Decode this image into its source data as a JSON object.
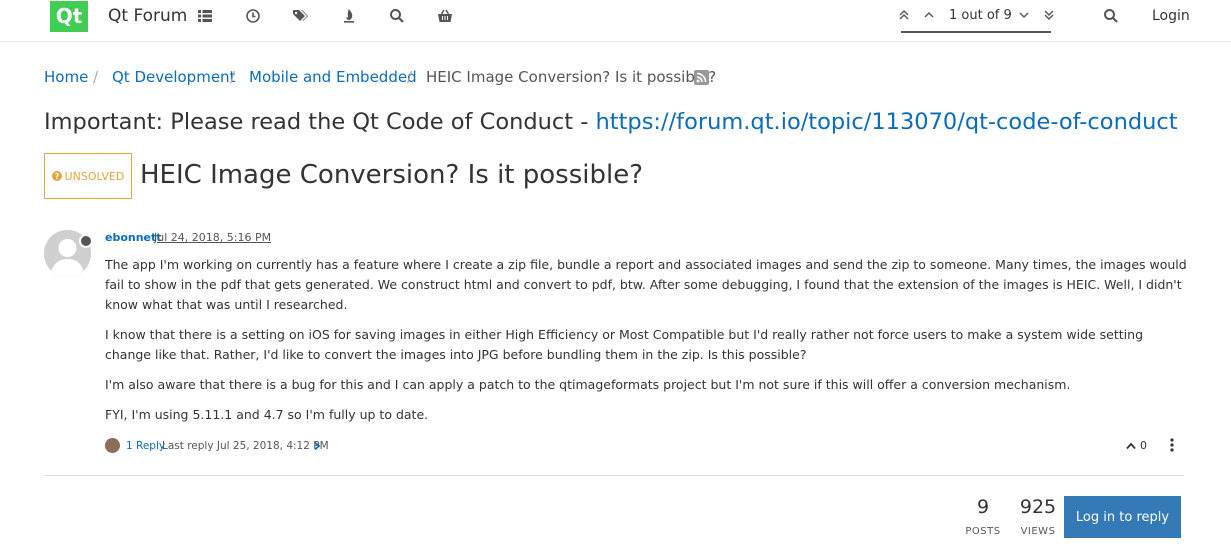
{
  "header": {
    "logo_text": "Qt",
    "brand": "Qt Forum",
    "nav_icons": [
      "categories-icon",
      "recent-icon",
      "tags-icon",
      "popular-icon",
      "search-icon",
      "shop-icon"
    ],
    "pager": {
      "text": "1 out of 9"
    },
    "search_icon": "search-icon",
    "login_label": "Login"
  },
  "breadcrumb": {
    "items": [
      "Home",
      "Qt Development",
      "Mobile and Embedded"
    ],
    "current": "HEIC Image Conversion? Is it possible?",
    "separator": "/"
  },
  "notice": {
    "text": "Important: Please read the Qt Code of Conduct - ",
    "link": "https://forum.qt.io/topic/113070/qt-code-of-conduct"
  },
  "topic": {
    "status": "UNSOLVED",
    "title": "HEIC Image Conversion? Is it possible?"
  },
  "post": {
    "author": "ebonnett",
    "timestamp": "Jul 24, 2018, 5:16 PM",
    "paragraphs": [
      "The app I'm working on currently has a feature where I create a zip file, bundle a report and associated images and send the zip to someone. Many times, the images would fail to show in the pdf that gets generated. We construct html and convert to pdf, btw. After some debugging, I found that the extension of the images is HEIC. Well, I didn't know what that was until I researched.",
      "I know that there is a setting on iOS for saving images in either High Efficiency or Most Compatible but I'd really rather not force users to make a system wide setting change like that. Rather, I'd like to convert the images into JPG before bundling them in the zip. Is this possible?",
      "I'm also aware that there is a bug for this and I can apply a patch to the qtimageformats project but I'm not sure if this will offer a conversion mechanism.",
      "FYI, I'm using 5.11.1 and 4.7 so I'm fully up to date."
    ],
    "replies_label": "1 Reply",
    "last_reply": "Last reply Jul 25, 2018, 4:12 PM",
    "votes": "0"
  },
  "stats": {
    "posts": "9",
    "posts_label": "POSTS",
    "views": "925",
    "views_label": "VIEWS"
  },
  "actions": {
    "reply_button": "Log in to reply"
  },
  "colors": {
    "qt_green": "#41cd52",
    "link": "#0a6cbc",
    "unsolved": "#e8a33d",
    "button": "#337ab7"
  }
}
